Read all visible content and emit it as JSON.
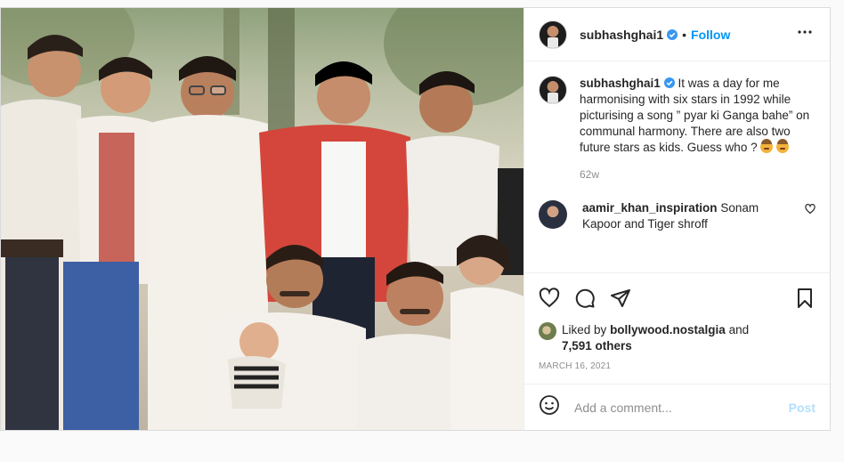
{
  "header": {
    "username": "subhashghai1",
    "follow_label": "Follow",
    "separator": "•",
    "more_label": "•••"
  },
  "caption": {
    "username": "subhashghai1",
    "text": "It was a day for me harmonising with six stars in 1992 while picturising a song ” pyar ki Ganga bahe” on communal harmony. There are also two future stars as kids. Guess who ?",
    "time_ago": "62w"
  },
  "comments": [
    {
      "username": "aamir_khan_inspiration",
      "text": "Sonam Kapoor and Tiger shroff"
    }
  ],
  "likes": {
    "prefix": "Liked by",
    "user": "bollywood.nostalgia",
    "and": "and",
    "others": "7,591 others"
  },
  "date": "MARCH 16, 2021",
  "add_comment": {
    "placeholder": "Add a comment...",
    "post_label": "Post"
  },
  "icons": {
    "verified": "verified-badge-icon",
    "more": "more-options-icon",
    "like": "heart-icon",
    "comment": "comment-icon",
    "share": "share-icon",
    "save": "bookmark-icon",
    "emoji": "emoji-icon",
    "comment_like": "small-heart-icon"
  },
  "colors": {
    "accent": "#0095f6",
    "post_disabled": "#b2dffc",
    "muted": "#8e8e8e",
    "verified": "#3897f0"
  }
}
